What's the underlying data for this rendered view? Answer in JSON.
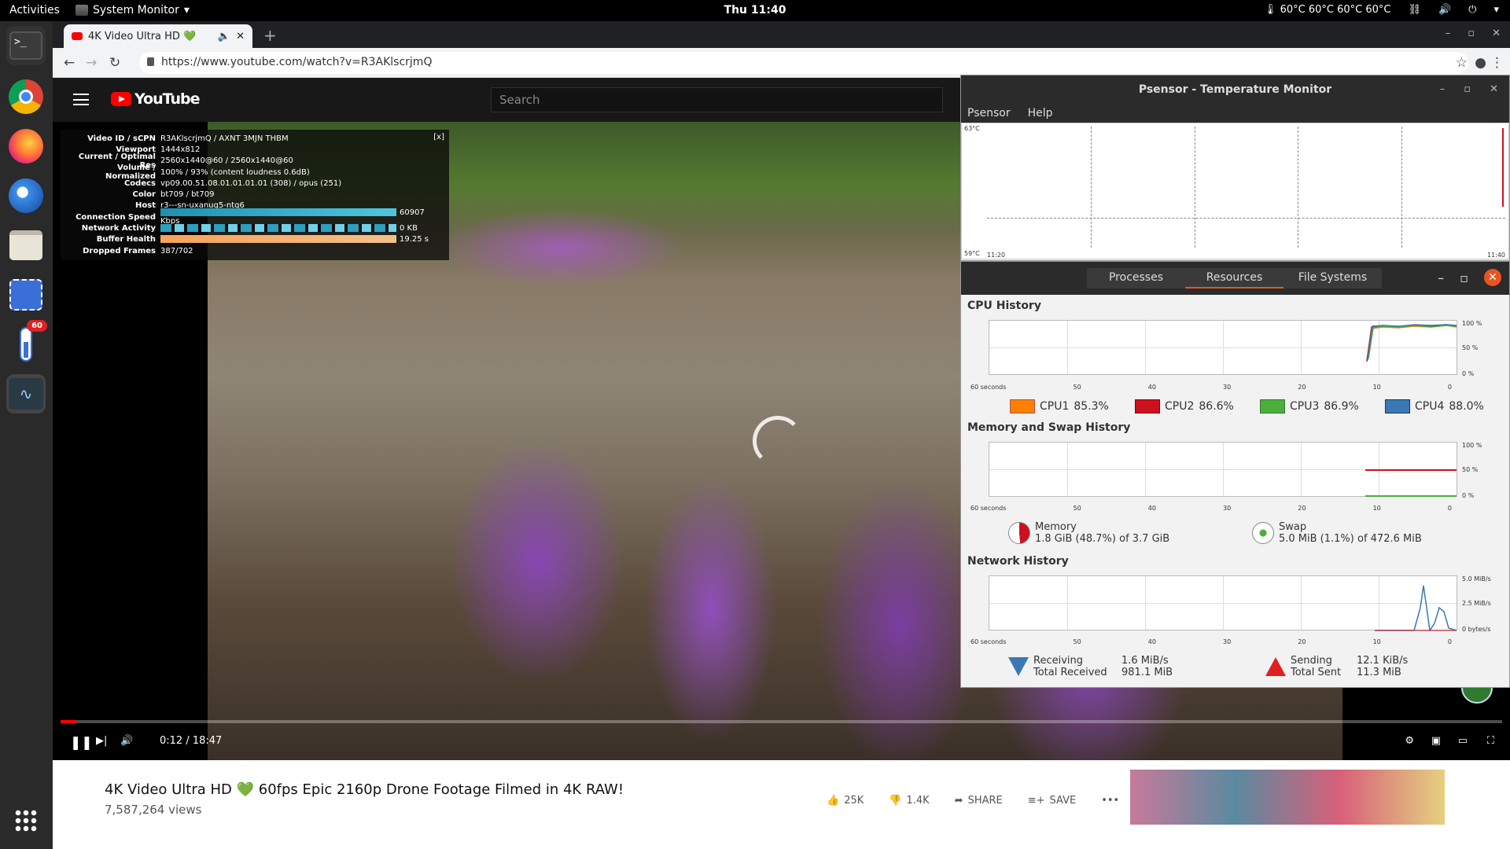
{
  "topbar": {
    "activities": "Activities",
    "app_menu": "System Monitor",
    "clock": "Thu 11:40",
    "temps": "60°C 60°C 60°C 60°C"
  },
  "dock": {
    "badge": "60",
    "items": [
      "terminal-icon",
      "chrome-icon",
      "firefox-icon",
      "thunderbird-icon",
      "files-icon",
      "screenshot-icon",
      "psensor-icon",
      "system-monitor-icon",
      "app-grid-icon"
    ]
  },
  "browser": {
    "tab_title": "4K Video Ultra HD 💚",
    "url": "https://www.youtube.com/watch?v=R3AKlscrjmQ"
  },
  "youtube": {
    "logo": "YouTube",
    "search_placeholder": "Search",
    "time": "0:12 / 18:47",
    "progress_fraction": 0.011,
    "video_title": "4K Video Ultra HD 💚 60fps Epic 2160p Drone Footage Filmed in 4K RAW!",
    "views": "7,587,264 views",
    "likes": "25K",
    "dislikes": "1.4K",
    "share": "SHARE",
    "save": "SAVE"
  },
  "stats": {
    "close": "[x]",
    "rows": [
      {
        "label": "Video ID / sCPN",
        "value": "R3AKlscrjmQ / AXNT 3MJN THBM"
      },
      {
        "label": "Viewport",
        "value": "1444x812"
      },
      {
        "label": "Current / Optimal Res",
        "value": "2560x1440@60 / 2560x1440@60"
      },
      {
        "label": "Volume / Normalized",
        "value": "100% / 93% (content loudness 0.6dB)"
      },
      {
        "label": "Codecs",
        "value": "vp09.00.51.08.01.01.01.01 (308) / opus (251)"
      },
      {
        "label": "Color",
        "value": "bt709 / bt709"
      },
      {
        "label": "Host",
        "value": "r3---sn-uxanug5-ntq6"
      },
      {
        "label": "Connection Speed",
        "value": "60907 Kbps"
      },
      {
        "label": "Network Activity",
        "value": "0 KB"
      },
      {
        "label": "Buffer Health",
        "value": "19.25 s"
      },
      {
        "label": "Dropped Frames",
        "value": "387/702"
      }
    ]
  },
  "psensor": {
    "title": "Psensor - Temperature Monitor",
    "menu": [
      "Psensor",
      "Help"
    ],
    "y_top": "63°C",
    "y_bottom": "59°C",
    "x_start": "11:20",
    "x_end": "11:40"
  },
  "sysmon": {
    "tabs": [
      "Processes",
      "Resources",
      "File Systems"
    ],
    "cpu_title": "CPU History",
    "mem_title": "Memory and Swap History",
    "net_title": "Network History",
    "x_ticks": [
      "60 seconds",
      "50",
      "40",
      "30",
      "20",
      "10",
      "0"
    ],
    "cpu_y": [
      "100 %",
      "50 %",
      "0 %"
    ],
    "net_y": [
      "5.0 MiB/s",
      "2.5 MiB/s",
      "0 bytes/s"
    ],
    "cpus": [
      {
        "label": "CPU1",
        "value": "85.3%",
        "color": "#ff7f00"
      },
      {
        "label": "CPU2",
        "value": "86.6%",
        "color": "#cc1020"
      },
      {
        "label": "CPU3",
        "value": "86.9%",
        "color": "#4caf3c"
      },
      {
        "label": "CPU4",
        "value": "88.0%",
        "color": "#3a78b5"
      }
    ],
    "memory": {
      "label": "Memory",
      "value": "1.8 GiB (48.7%) of 3.7 GiB"
    },
    "swap": {
      "label": "Swap",
      "value": "5.0 MiB (1.1%) of 472.6 MiB"
    },
    "net": {
      "receiving_label": "Receiving",
      "receiving": "1.6 MiB/s",
      "total_received_label": "Total Received",
      "total_received": "981.1 MiB",
      "sending_label": "Sending",
      "sending": "12.1 KiB/s",
      "total_sent_label": "Total Sent",
      "total_sent": "11.3 MiB"
    }
  }
}
